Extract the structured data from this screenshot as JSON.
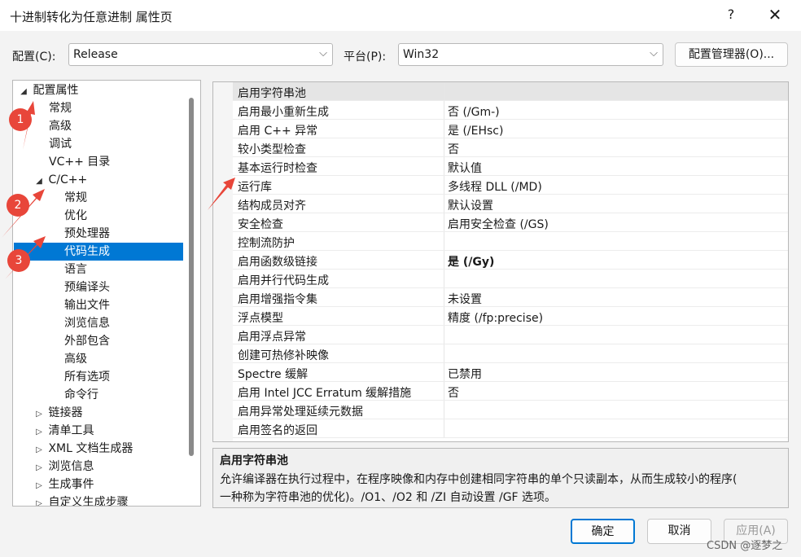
{
  "window": {
    "title": "十进制转化为任意进制 属性页",
    "help": "?",
    "close": "✕"
  },
  "config": {
    "label": "配置(C):",
    "value": "Release"
  },
  "platform": {
    "label": "平台(P):",
    "value": "Win32"
  },
  "config_manager_label": "配置管理器(O)...",
  "tree": {
    "items": [
      {
        "label": "配置属性",
        "twisty": "◢"
      },
      {
        "label": "常规",
        "twisty": ""
      },
      {
        "label": "高级",
        "twisty": ""
      },
      {
        "label": "调试",
        "twisty": ""
      },
      {
        "label": "VC++ 目录",
        "twisty": ""
      },
      {
        "label": "C/C++",
        "twisty": "◢"
      },
      {
        "label": "常规",
        "twisty": ""
      },
      {
        "label": "优化",
        "twisty": ""
      },
      {
        "label": "预处理器",
        "twisty": ""
      },
      {
        "label": "代码生成",
        "twisty": ""
      },
      {
        "label": "语言",
        "twisty": ""
      },
      {
        "label": "预编译头",
        "twisty": ""
      },
      {
        "label": "输出文件",
        "twisty": ""
      },
      {
        "label": "浏览信息",
        "twisty": ""
      },
      {
        "label": "外部包含",
        "twisty": ""
      },
      {
        "label": "高级",
        "twisty": ""
      },
      {
        "label": "所有选项",
        "twisty": ""
      },
      {
        "label": "命令行",
        "twisty": ""
      },
      {
        "label": "链接器",
        "twisty": "▷"
      },
      {
        "label": "清单工具",
        "twisty": "▷"
      },
      {
        "label": "XML 文档生成器",
        "twisty": "▷"
      },
      {
        "label": "浏览信息",
        "twisty": "▷"
      },
      {
        "label": "生成事件",
        "twisty": "▷"
      },
      {
        "label": "自定义生成步骤",
        "twisty": "▷"
      }
    ]
  },
  "grid": {
    "rows": [
      {
        "name": "启用字符串池",
        "value": ""
      },
      {
        "name": "启用最小重新生成",
        "value": "否 (/Gm-)"
      },
      {
        "name": "启用 C++ 异常",
        "value": "是 (/EHsc)"
      },
      {
        "name": "较小类型检查",
        "value": "否"
      },
      {
        "name": "基本运行时检查",
        "value": "默认值"
      },
      {
        "name": "运行库",
        "value": "多线程 DLL (/MD)"
      },
      {
        "name": "结构成员对齐",
        "value": "默认设置"
      },
      {
        "name": "安全检查",
        "value": "启用安全检查 (/GS)"
      },
      {
        "name": "控制流防护",
        "value": ""
      },
      {
        "name": "启用函数级链接",
        "value": "是 (/Gy)"
      },
      {
        "name": "启用并行代码生成",
        "value": ""
      },
      {
        "name": "启用增强指令集",
        "value": "未设置"
      },
      {
        "name": "浮点模型",
        "value": "精度 (/fp:precise)"
      },
      {
        "name": "启用浮点异常",
        "value": ""
      },
      {
        "name": "创建可热修补映像",
        "value": ""
      },
      {
        "name": "Spectre 缓解",
        "value": "已禁用"
      },
      {
        "name": "启用 Intel JCC Erratum 缓解措施",
        "value": "否"
      },
      {
        "name": "启用异常处理延续元数据",
        "value": ""
      },
      {
        "name": "启用签名的返回",
        "value": ""
      }
    ]
  },
  "description": {
    "title": "启用字符串池",
    "line1": "允许编译器在执行过程中，在程序映像和内存中创建相同字符串的单个只读副本，从而生成较小的程序(",
    "line2": "一种称为字符串池的优化)。/O1、/O2 和 /ZI 自动设置 /GF 选项。"
  },
  "buttons": {
    "ok": "确定",
    "cancel": "取消",
    "apply": "应用(A)"
  },
  "annotations": [
    "1",
    "2",
    "3"
  ],
  "colors": {
    "selection": "#0078d4",
    "annotation": "#e8463a"
  },
  "watermark": "CSDN @逐梦之"
}
